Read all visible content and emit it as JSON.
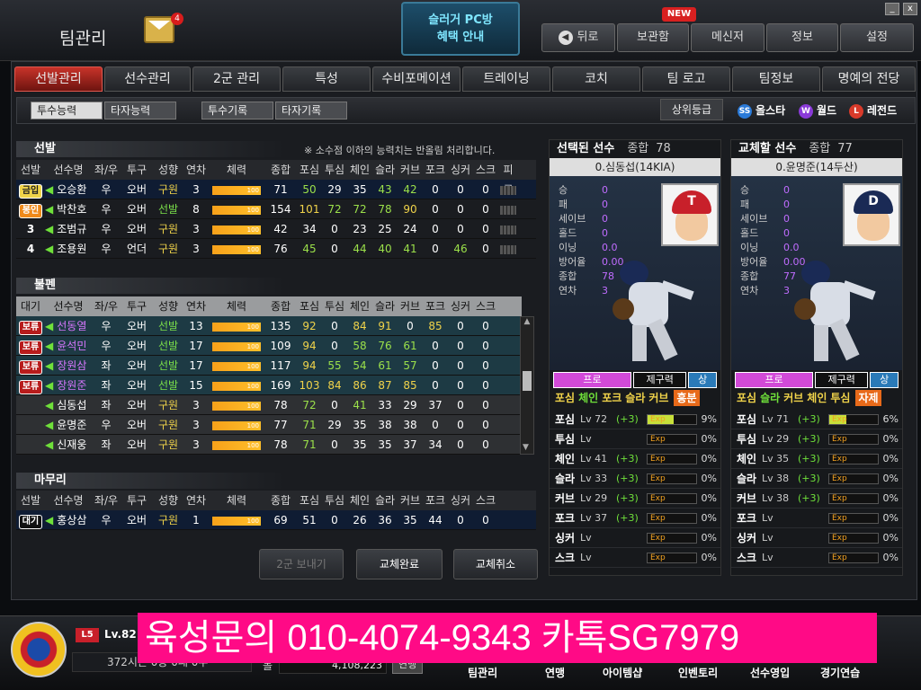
{
  "top": {
    "title": "팀관리",
    "mail_count": "4",
    "slugger_line1": "슬러거 PC방",
    "slugger_line2": "혜택 안내",
    "nav": [
      {
        "label": "뒤로"
      },
      {
        "label": "보관함"
      },
      {
        "label": "메신저"
      },
      {
        "label": "정보"
      },
      {
        "label": "설정"
      }
    ],
    "new_badge": "NEW",
    "win_min": "_",
    "win_close": "x"
  },
  "tabs": [
    {
      "label": "선발관리"
    },
    {
      "label": "선수관리"
    },
    {
      "label": "2군 관리"
    },
    {
      "label": "특성"
    },
    {
      "label": "수비포메이션"
    },
    {
      "label": "트레이닝"
    },
    {
      "label": "코치"
    },
    {
      "label": "팀 로고"
    },
    {
      "label": "팀정보"
    },
    {
      "label": "명예의 전당"
    }
  ],
  "subtabs": [
    {
      "label": "투수능력"
    },
    {
      "label": "타자능력"
    },
    {
      "label": "투수기록"
    },
    {
      "label": "타자기록"
    }
  ],
  "grade": {
    "label": "상위등급",
    "allstar_icon": "SS",
    "allstar": "올스타",
    "world_icon": "W",
    "world": "월드",
    "legend_icon": "L",
    "legend": "레전드"
  },
  "rotation": {
    "title": "선발",
    "note": "※ 소수점 이하의 능력치는 반올림 처리합니다.",
    "headers": [
      "선발",
      "선수명",
      "좌/우",
      "투구",
      "성향",
      "연차",
      "체력",
      "종합",
      "포심",
      "투심",
      "체인",
      "슬라",
      "커브",
      "포크",
      "싱커",
      "스크",
      "피로"
    ],
    "rows": [
      {
        "badge": "금입",
        "name": "오승환",
        "hand": "우",
        "style": "오버",
        "trait": "구원",
        "year": "3",
        "stamina": "100",
        "ovr": "71",
        "v": [
          "50",
          "29",
          "35",
          "43",
          "42",
          "0",
          "0",
          "0"
        ]
      },
      {
        "badge": "봉인",
        "name": "박찬호",
        "hand": "우",
        "style": "오버",
        "trait": "선발",
        "year": "8",
        "stamina": "100",
        "ovr": "154",
        "v": [
          "101",
          "72",
          "72",
          "78",
          "90",
          "0",
          "0",
          "0"
        ]
      },
      {
        "badge": "3",
        "name": "조범규",
        "hand": "우",
        "style": "오버",
        "trait": "구원",
        "year": "3",
        "stamina": "100",
        "ovr": "42",
        "v": [
          "34",
          "0",
          "23",
          "25",
          "24",
          "0",
          "0",
          "0"
        ]
      },
      {
        "badge": "4",
        "name": "조용원",
        "hand": "우",
        "style": "언더",
        "trait": "구원",
        "year": "3",
        "stamina": "100",
        "ovr": "76",
        "v": [
          "45",
          "0",
          "44",
          "40",
          "41",
          "0",
          "46",
          "0"
        ]
      }
    ]
  },
  "bullpen": {
    "title": "불펜",
    "headers": [
      "대기",
      "선수명",
      "좌/우",
      "투구",
      "성향",
      "연차",
      "체력",
      "종합",
      "포심",
      "투심",
      "체인",
      "슬라",
      "커브",
      "포크",
      "싱커",
      "스크"
    ],
    "rows": [
      {
        "badge": "보류",
        "name": "선동열",
        "hand": "우",
        "style": "오버",
        "trait": "선발",
        "year": "13",
        "stamina": "100",
        "ovr": "135",
        "v": [
          "92",
          "0",
          "84",
          "91",
          "0",
          "85",
          "0",
          "0"
        ]
      },
      {
        "badge": "보류",
        "name": "윤석민",
        "hand": "우",
        "style": "오버",
        "trait": "선발",
        "year": "17",
        "stamina": "100",
        "ovr": "109",
        "v": [
          "94",
          "0",
          "58",
          "76",
          "61",
          "0",
          "0",
          "0"
        ]
      },
      {
        "badge": "보류",
        "name": "장원삼",
        "hand": "좌",
        "style": "오버",
        "trait": "선발",
        "year": "17",
        "stamina": "100",
        "ovr": "117",
        "v": [
          "94",
          "55",
          "54",
          "61",
          "57",
          "0",
          "0",
          "0"
        ]
      },
      {
        "badge": "보류",
        "name": "장원준",
        "hand": "좌",
        "style": "오버",
        "trait": "선발",
        "year": "15",
        "stamina": "100",
        "ovr": "169",
        "v": [
          "103",
          "84",
          "86",
          "87",
          "85",
          "0",
          "0",
          "0"
        ]
      },
      {
        "badge": "",
        "name": "심동섭",
        "hand": "좌",
        "style": "오버",
        "trait": "구원",
        "year": "3",
        "stamina": "100",
        "ovr": "78",
        "v": [
          "72",
          "0",
          "41",
          "33",
          "29",
          "37",
          "0",
          "0"
        ]
      },
      {
        "badge": "",
        "name": "윤명준",
        "hand": "우",
        "style": "오버",
        "trait": "구원",
        "year": "3",
        "stamina": "100",
        "ovr": "77",
        "v": [
          "71",
          "29",
          "35",
          "38",
          "38",
          "0",
          "0",
          "0"
        ]
      },
      {
        "badge": "",
        "name": "신재웅",
        "hand": "좌",
        "style": "오버",
        "trait": "구원",
        "year": "3",
        "stamina": "100",
        "ovr": "78",
        "v": [
          "71",
          "0",
          "35",
          "35",
          "37",
          "34",
          "0",
          "0"
        ]
      }
    ]
  },
  "closer": {
    "title": "마무리",
    "headers": [
      "선발",
      "선수명",
      "좌/우",
      "투구",
      "성향",
      "연차",
      "체력",
      "종합",
      "포심",
      "투심",
      "체인",
      "슬라",
      "커브",
      "포크",
      "싱커",
      "스크"
    ],
    "rows": [
      {
        "badge": "대기",
        "name": "홍상삼",
        "hand": "우",
        "style": "오버",
        "trait": "구원",
        "year": "1",
        "stamina": "100",
        "ovr": "69",
        "v": [
          "51",
          "0",
          "26",
          "36",
          "35",
          "44",
          "0",
          "0"
        ]
      }
    ]
  },
  "actions": {
    "send_down": "2군 보내기",
    "confirm": "교체완료",
    "cancel": "교체취소"
  },
  "selected": {
    "header": "선택된 선수",
    "ovr_label": "종합",
    "ovr": "78",
    "name": "0.심동섭(14KIA)",
    "cap_letter": "T",
    "stats": [
      {
        "k": "승",
        "v": "0"
      },
      {
        "k": "패",
        "v": "0"
      },
      {
        "k": "세이브",
        "v": "0"
      },
      {
        "k": "홀드",
        "v": "0"
      },
      {
        "k": "이닝",
        "v": "0.0"
      },
      {
        "k": "방어율",
        "v": "0.00"
      },
      {
        "k": "종합",
        "v": "78"
      },
      {
        "k": "연차",
        "v": "3"
      }
    ],
    "rank": "프로",
    "control_label": "제구력",
    "control": "상",
    "pitches": [
      "포심",
      "체인",
      "포크",
      "슬라",
      "커브"
    ],
    "feature": "흥분",
    "skills": [
      {
        "n": "포심",
        "lv": "72",
        "plus": "(+3)",
        "exp": "Exp",
        "pct": "9%"
      },
      {
        "n": "투심",
        "lv": "",
        "plus": "",
        "exp": "Exp",
        "pct": "0%"
      },
      {
        "n": "체인",
        "lv": "41",
        "plus": "(+3)",
        "exp": "Exp",
        "pct": "0%"
      },
      {
        "n": "슬라",
        "lv": "33",
        "plus": "(+3)",
        "exp": "Exp",
        "pct": "0%"
      },
      {
        "n": "커브",
        "lv": "29",
        "plus": "(+3)",
        "exp": "Exp",
        "pct": "0%"
      },
      {
        "n": "포크",
        "lv": "37",
        "plus": "(+3)",
        "exp": "Exp",
        "pct": "0%"
      },
      {
        "n": "싱커",
        "lv": "",
        "plus": "",
        "exp": "Exp",
        "pct": "0%"
      },
      {
        "n": "스크",
        "lv": "",
        "plus": "",
        "exp": "Exp",
        "pct": "0%"
      }
    ]
  },
  "swap": {
    "header": "교체할 선수",
    "ovr_label": "종합",
    "ovr": "77",
    "name": "0.윤명준(14두산)",
    "cap_letter": "D",
    "stats": [
      {
        "k": "승",
        "v": "0"
      },
      {
        "k": "패",
        "v": "0"
      },
      {
        "k": "세이브",
        "v": "0"
      },
      {
        "k": "홀드",
        "v": "0"
      },
      {
        "k": "이닝",
        "v": "0.0"
      },
      {
        "k": "방어율",
        "v": "0.00"
      },
      {
        "k": "종합",
        "v": "77"
      },
      {
        "k": "연차",
        "v": "3"
      }
    ],
    "rank": "프로",
    "control_label": "제구력",
    "control": "상",
    "pitches": [
      "포심",
      "슬라",
      "커브",
      "체인",
      "투심"
    ],
    "feature": "자제",
    "skills": [
      {
        "n": "포심",
        "lv": "71",
        "plus": "(+3)",
        "exp": "Exp",
        "pct": "6%"
      },
      {
        "n": "투심",
        "lv": "29",
        "plus": "(+3)",
        "exp": "Exp",
        "pct": "0%"
      },
      {
        "n": "체인",
        "lv": "35",
        "plus": "(+3)",
        "exp": "Exp",
        "pct": "0%"
      },
      {
        "n": "슬라",
        "lv": "38",
        "plus": "(+3)",
        "exp": "Exp",
        "pct": "0%"
      },
      {
        "n": "커브",
        "lv": "38",
        "plus": "(+3)",
        "exp": "Exp",
        "pct": "0%"
      },
      {
        "n": "포크",
        "lv": "",
        "plus": "",
        "exp": "Exp",
        "pct": "0%"
      },
      {
        "n": "싱커",
        "lv": "",
        "plus": "",
        "exp": "Exp",
        "pct": "0%"
      },
      {
        "n": "스크",
        "lv": "",
        "plus": "",
        "exp": "Exp",
        "pct": "0%"
      }
    ]
  },
  "bottom": {
    "level_badge": "L5",
    "level": "Lv.82",
    "season": "372시즌 0승 0패 0무",
    "money_label": "볼",
    "money": "4,108,223",
    "link_btn": "연맹",
    "promo": "육성문의 010-4074-9343 카톡SG7979",
    "menu": [
      {
        "label": "팀관리"
      },
      {
        "label": "연맹"
      },
      {
        "label": "아이템샵"
      },
      {
        "label": "인벤토리"
      },
      {
        "label": "선수영입"
      },
      {
        "label": "경기연습"
      }
    ]
  }
}
